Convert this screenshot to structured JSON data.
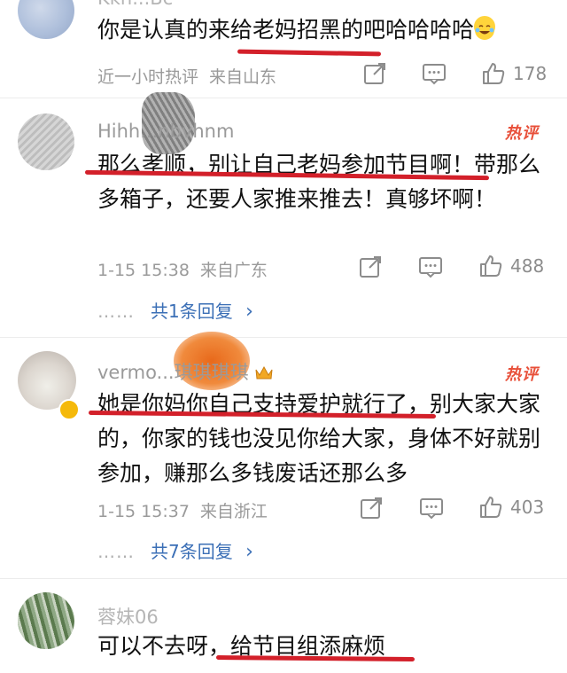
{
  "comments": [
    {
      "username": "Kkh...Bc",
      "text": "你是认真的来给老妈招黑的吧哈哈哈哈",
      "emoji": "laughing-tears-emoji",
      "time": "近一小时热评",
      "location": "来自山东",
      "likes": "178"
    },
    {
      "username": "Hihh...nbvhnm",
      "hot_label": "热评",
      "text": "那么孝顺，别让自己老妈参加节目啊！带那么多箱子，还要人家推来推去！真够坏啊！",
      "time": "1-15 15:38",
      "location": "来自广东",
      "likes": "488",
      "replies_label": "共1条回复",
      "replies_dots": "……",
      "replies_chevron": "›"
    },
    {
      "username": "vermo...琪琪琪琪",
      "hot_label": "热评",
      "text": "她是你妈你自己支持爱护就行了，别大家大家的，你家的钱也没见你给大家，身体不好就别参加，赚那么多钱废话还那么多",
      "time": "1-15 15:37",
      "location": "来自浙江",
      "likes": "403",
      "replies_label": "共7条回复",
      "replies_dots": "……",
      "replies_chevron": "›"
    },
    {
      "username": "蓉妹06",
      "text": "可以不去呀，给节目组添麻烦"
    }
  ],
  "colors": {
    "hot": "#e8503a",
    "link": "#3b6fb6",
    "underline": "#d3202a",
    "meta": "#9a9a9a"
  },
  "icons": [
    "share-icon",
    "comment-icon",
    "like-icon",
    "crown-icon",
    "vip-badge-icon"
  ]
}
